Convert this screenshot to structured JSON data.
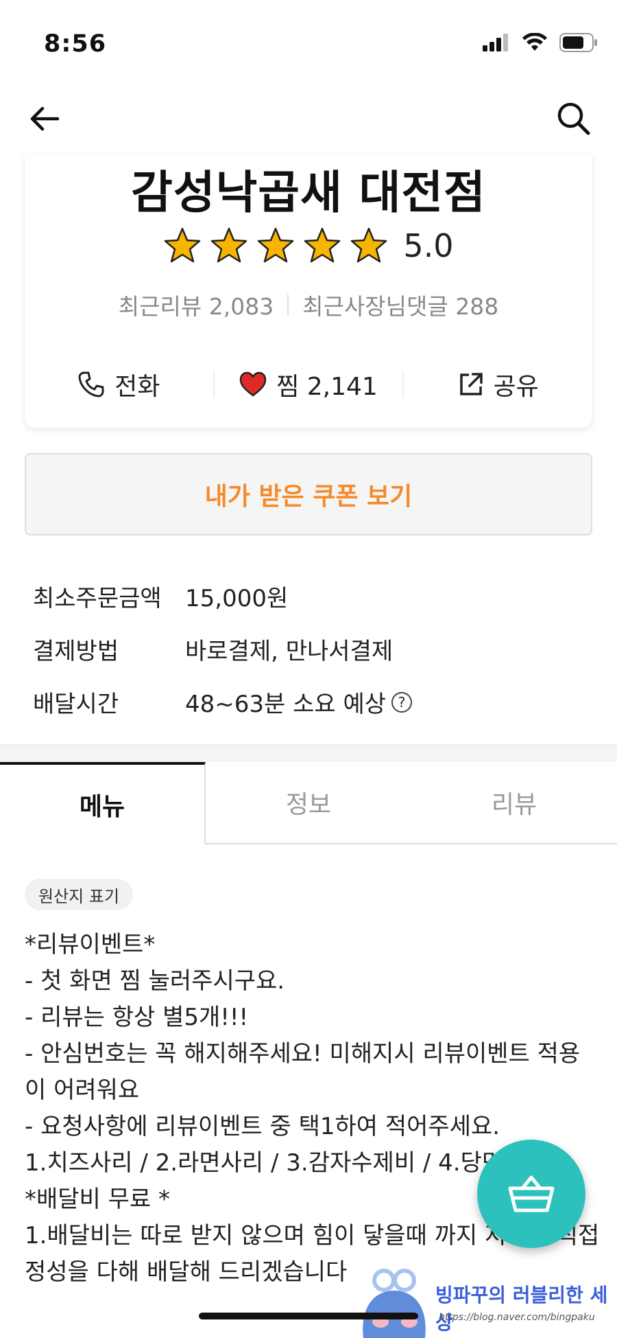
{
  "status_bar": {
    "time": "8:56"
  },
  "store": {
    "name": "감성낙곱새 대전점",
    "rating": "5.0",
    "stars": 5,
    "recent_reviews_label": "최근리뷰 2,083",
    "owner_replies_label": "최근사장님댓글 288",
    "actions": {
      "call": "전화",
      "like": "찜 2,141",
      "share": "공유"
    }
  },
  "coupon": {
    "label": "내가 받은 쿠폰 보기"
  },
  "info": [
    {
      "label": "최소주문금액",
      "value": "15,000원"
    },
    {
      "label": "결제방법",
      "value": "바로결제, 만나서결제"
    },
    {
      "label": "배달시간",
      "value": "48~63분 소요 예상"
    }
  ],
  "tabs": [
    {
      "label": "메뉴",
      "active": true
    },
    {
      "label": "정보",
      "active": false
    },
    {
      "label": "리뷰",
      "active": false
    }
  ],
  "origin_chip": "원산지 표기",
  "description": [
    "*리뷰이벤트*",
    "- 첫 화면 찜 눌러주시구요.",
    "- 리뷰는 항상 별5개!!!",
    "- 안심번호는 꼭 해지해주세요! 미해지시 리뷰이벤트 적용이 어려워요",
    "- 요청사항에 리뷰이벤트 중 택1하여 적어주세요.",
    "1.치즈사리 / 2.라면사리 / 3.감자수제비 / 4.당면",
    "",
    "*배달비 무료 *",
    "1.배달비는 따로 받지 않으며 힘이 닿을때 까지 저희가 직접 정성을 다해 배달해 드리겠습니다"
  ],
  "watermark": {
    "title": "빙파꾸의 러블리한 세상",
    "url": "https://blog.naver.com/bingpaku"
  },
  "colors": {
    "accent": "#f58a2b",
    "fab": "#2cc1bd",
    "star": "#f7b500",
    "heart": "#e02a2a"
  }
}
